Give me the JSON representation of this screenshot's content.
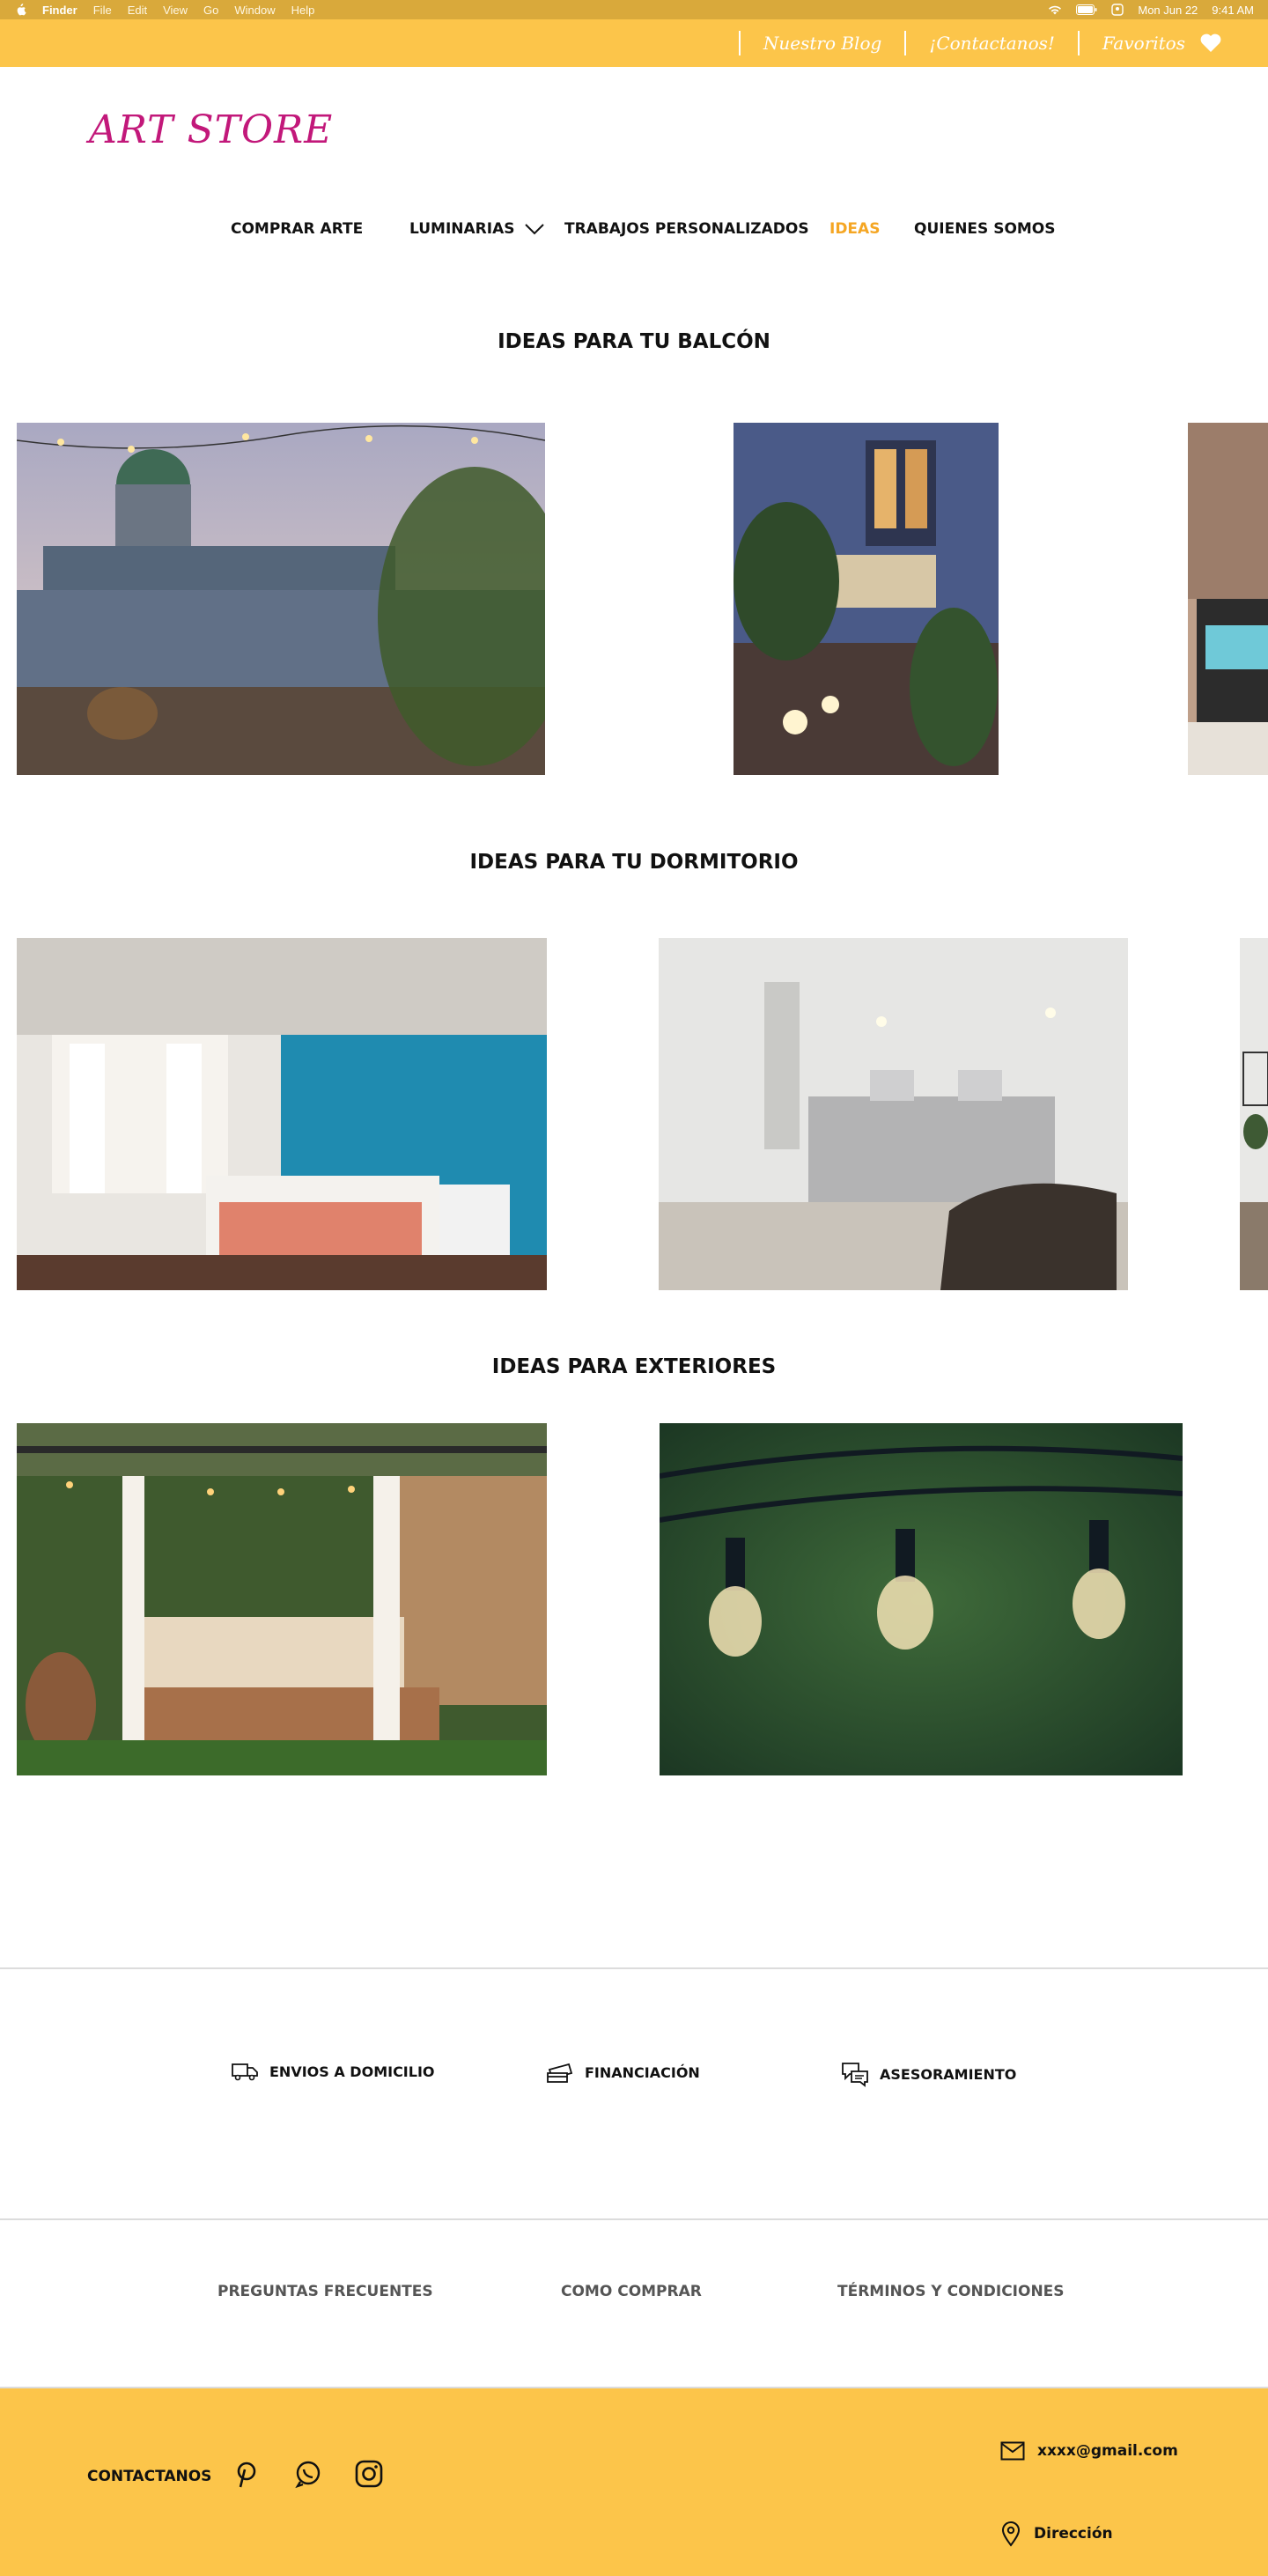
{
  "menubar": {
    "app": "Finder",
    "menus": [
      "File",
      "Edit",
      "View",
      "Go",
      "Window",
      "Help"
    ],
    "date": "Mon Jun 22",
    "time": "9:41 AM"
  },
  "topbar": {
    "blog": "Nuestro Blog",
    "contact": "¡Contactanos!",
    "favorites": "Favoritos"
  },
  "logo": "ART STORE",
  "nav": {
    "items": [
      "COMPRAR ARTE",
      "LUMINARIAS",
      "TRABAJOS PERSONALIZADOS",
      "IDEAS",
      "QUIENES SOMOS"
    ],
    "active": "IDEAS"
  },
  "sections": {
    "balcon": "IDEAS PARA TU BALCÓN",
    "dormitorio": "IDEAS PARA TU DORMITORIO",
    "exteriores": "IDEAS PARA EXTERIORES"
  },
  "features": {
    "envios": "ENVIOS A  DOMICILIO",
    "financiacion": "FINANCIACIÓN",
    "asesoramiento": "ASESORAMIENTO"
  },
  "footer_links": {
    "faq": "PREGUNTAS FRECUENTES",
    "how": "COMO COMPRAR",
    "terms": "TÉRMINOS Y CONDICIONES"
  },
  "footer": {
    "contact_label": "CONTACTANOS",
    "email": "xxxx@gmail.com",
    "address": "Dirección"
  },
  "colors": {
    "accent_yellow": "#fcc54a",
    "logo_magenta": "#c2187a",
    "nav_active": "#f5a623"
  }
}
